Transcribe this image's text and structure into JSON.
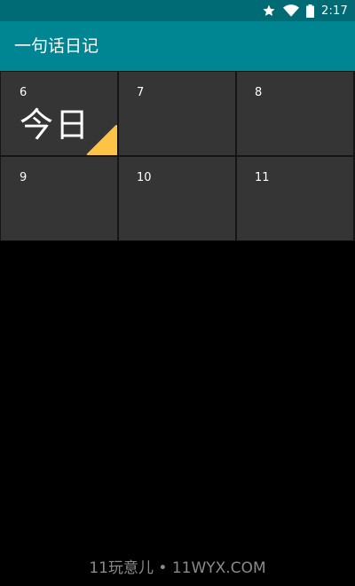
{
  "status_bar": {
    "time": "2:17",
    "icons": [
      "star-icon",
      "wifi-icon",
      "battery-icon"
    ]
  },
  "app_bar": {
    "title": "一句话日记"
  },
  "calendar": {
    "cells": [
      {
        "day": "6",
        "today": true,
        "today_label": "今日"
      },
      {
        "day": "7",
        "today": false
      },
      {
        "day": "8",
        "today": false
      },
      {
        "day": "9",
        "today": false
      },
      {
        "day": "10",
        "today": false
      },
      {
        "day": "11",
        "today": false
      }
    ],
    "today_corner_color": "#fcc345",
    "cell_color": "#353535"
  },
  "colors": {
    "status_bar": "#006a75",
    "app_bar": "#008593",
    "background": "#000000"
  },
  "watermark": {
    "text": "11玩意儿 • 11WYX.COM"
  }
}
